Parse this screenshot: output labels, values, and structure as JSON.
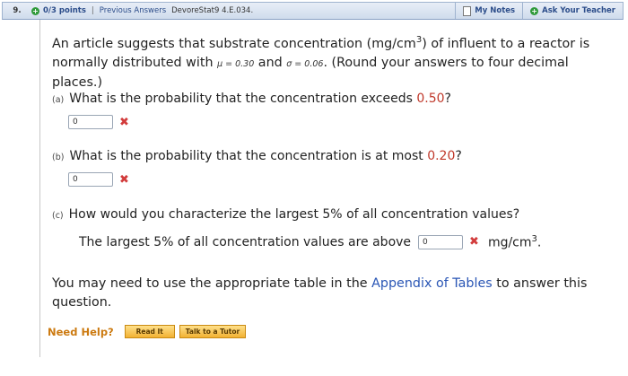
{
  "header": {
    "question_number": "9.",
    "points": "0/3 points",
    "separator": "|",
    "previous_answers": "Previous Answers",
    "problem_code": "DevoreStat9 4.E.034.",
    "my_notes": "My Notes",
    "ask_teacher": "Ask Your Teacher"
  },
  "intro": {
    "text1": "An article suggests that substrate concentration (mg/cm",
    "sup3": "3",
    "text2": ") of influent to a reactor is normally distributed with ",
    "mu": "μ = 0.30",
    "and": " and ",
    "sigma": "σ = 0.06",
    "text3": ". (Round your answers to four decimal places.)"
  },
  "parts": {
    "a": {
      "label": "(a)",
      "text": "What is the probability that the concentration exceeds ",
      "value": "0.50",
      "end": "?",
      "answer": "0"
    },
    "b": {
      "label": "(b)",
      "text": "What is the probability that the concentration is at most ",
      "value": "0.20",
      "end": "?",
      "answer": "0"
    },
    "c": {
      "label": "(c)",
      "text": "How would you characterize the largest 5% of all concentration values?",
      "statement": "The largest 5% of all concentration values are above",
      "answer": "0",
      "unit": "mg/cm",
      "unit_sup": "3",
      "unit_end": "."
    }
  },
  "footer": {
    "text1": "You may need to use the appropriate table in the ",
    "link": "Appendix of Tables",
    "text2": " to answer this question."
  },
  "help": {
    "label": "Need Help?",
    "read": "Read It",
    "tutor": "Talk to a Tutor"
  },
  "marks": {
    "incorrect": "✖"
  }
}
